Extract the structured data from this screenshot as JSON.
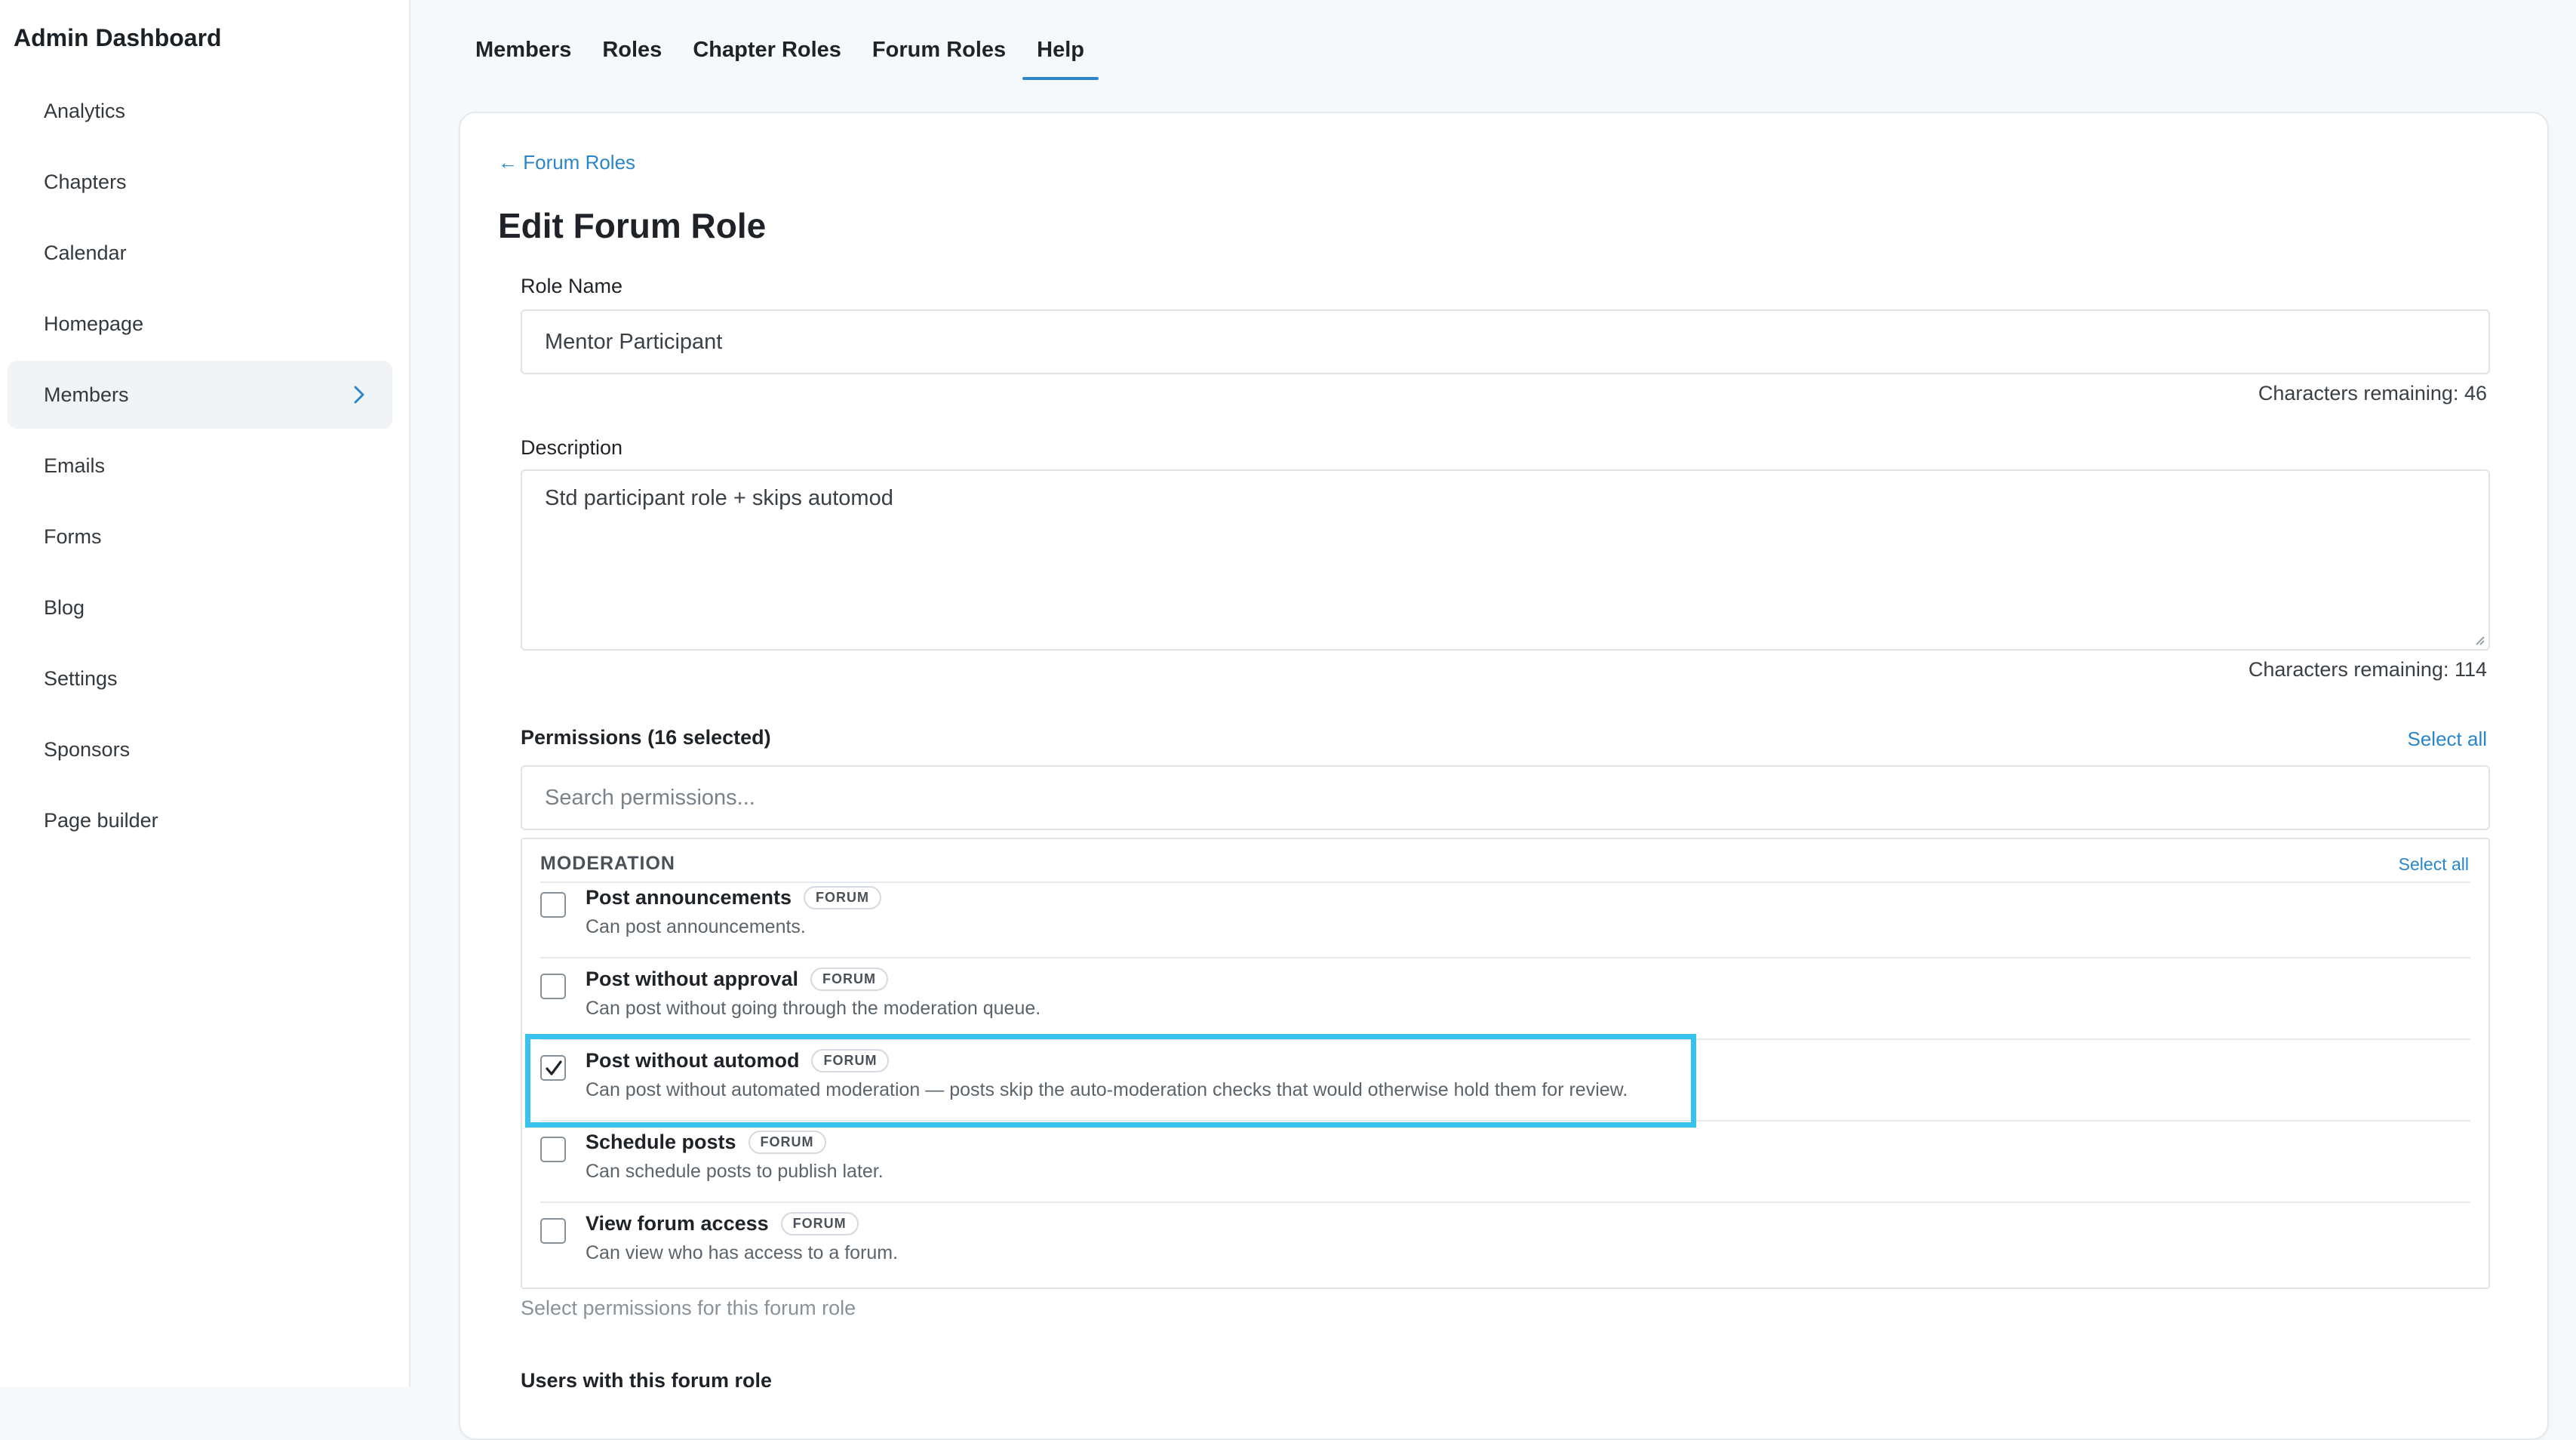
{
  "sidebar": {
    "title": "Admin Dashboard",
    "items": [
      {
        "label": "Analytics"
      },
      {
        "label": "Chapters"
      },
      {
        "label": "Calendar"
      },
      {
        "label": "Homepage"
      },
      {
        "label": "Members",
        "active": true
      },
      {
        "label": "Emails"
      },
      {
        "label": "Forms"
      },
      {
        "label": "Blog"
      },
      {
        "label": "Settings"
      },
      {
        "label": "Sponsors"
      },
      {
        "label": "Page builder"
      }
    ]
  },
  "tabs": [
    {
      "label": "Members"
    },
    {
      "label": "Roles"
    },
    {
      "label": "Chapter Roles"
    },
    {
      "label": "Forum Roles"
    },
    {
      "label": "Help",
      "active": true
    }
  ],
  "card": {
    "back_link": "← Forum Roles",
    "title": "Edit Forum Role",
    "role_name_label": "Role Name",
    "role_name_value": "Mentor Participant",
    "role_name_remaining": "Characters remaining: 46",
    "description_label": "Description",
    "description_value": "Std participant role + skips automod",
    "description_remaining": "Characters remaining: 114",
    "permissions_title": "Permissions (16 selected)",
    "select_all": "Select all",
    "search_placeholder": "Search permissions...",
    "helper_text": "Select permissions for this forum role",
    "users_title": "Users with this forum role"
  },
  "permission_group": {
    "name": "MODERATION",
    "select_all": "Select all",
    "permissions": [
      {
        "name": "Post announcements",
        "badge": "FORUM",
        "description": "Can post announcements.",
        "checked": false
      },
      {
        "name": "Post without approval",
        "badge": "FORUM",
        "description": "Can post without going through the moderation queue.",
        "checked": false
      },
      {
        "name": "Post without automod",
        "badge": "FORUM",
        "description": "Can post without automated moderation — posts skip the auto-moderation checks that would otherwise hold them for review.",
        "checked": true
      },
      {
        "name": "Schedule posts",
        "badge": "FORUM",
        "description": "Can schedule posts to publish later.",
        "checked": false
      },
      {
        "name": "View forum access",
        "badge": "FORUM",
        "description": "Can view who has access to a forum.",
        "checked": false
      }
    ]
  },
  "colors": {
    "accent": "#2a86c8",
    "highlight": "#38c3ec"
  }
}
